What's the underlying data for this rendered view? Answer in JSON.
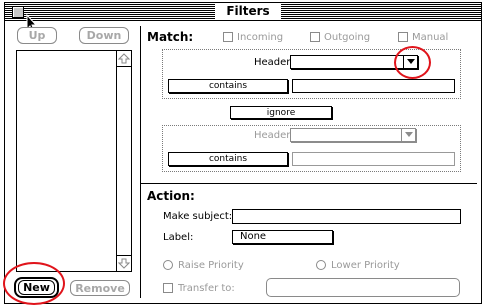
{
  "window": {
    "title": "Filters"
  },
  "list": {
    "up_label": "Up",
    "down_label": "Down",
    "new_label": "New",
    "remove_label": "Remove"
  },
  "match": {
    "heading": "Match:",
    "incoming_label": "Incoming",
    "outgoing_label": "Outgoing",
    "manual_label": "Manual",
    "header1_label": "Header:",
    "contains1_label": "contains",
    "ignore_label": "ignore",
    "header2_label": "Header:",
    "contains2_label": "contains"
  },
  "action": {
    "heading": "Action:",
    "make_subject_label": "Make subject:",
    "label_label": "Label:",
    "label_value": "None",
    "raise_priority_label": "Raise Priority",
    "lower_priority_label": "Lower Priority",
    "transfer_label": "Transfer to:"
  },
  "colors": {
    "annotation": "#e0141b"
  }
}
